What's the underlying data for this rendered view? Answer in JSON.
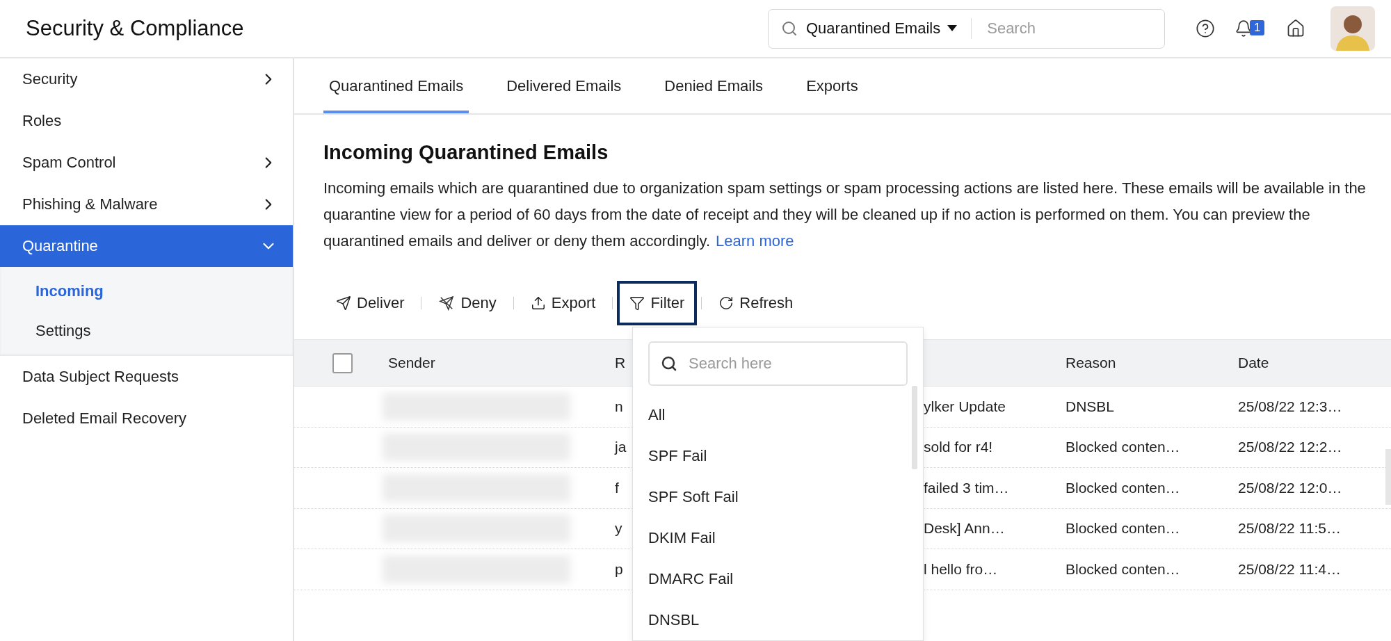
{
  "app_title": "Security & Compliance",
  "global_search": {
    "scope": "Quarantined Emails",
    "placeholder": "Search"
  },
  "notifications": {
    "count": "1"
  },
  "sidebar": {
    "items": [
      {
        "label": "Security",
        "kind": "group",
        "expanded": false,
        "selected": false
      },
      {
        "label": "Roles",
        "kind": "link",
        "selected": false
      },
      {
        "label": "Spam Control",
        "kind": "group",
        "expanded": false,
        "selected": false
      },
      {
        "label": "Phishing & Malware",
        "kind": "group",
        "expanded": false,
        "selected": false
      },
      {
        "label": "Quarantine",
        "kind": "group",
        "expanded": true,
        "selected": true,
        "children": [
          {
            "label": "Incoming",
            "selected": true
          },
          {
            "label": "Settings",
            "selected": false
          }
        ]
      },
      {
        "label": "Data Subject Requests",
        "kind": "link",
        "selected": false
      },
      {
        "label": "Deleted Email Recovery",
        "kind": "link",
        "selected": false
      }
    ]
  },
  "tabs": [
    {
      "label": "Quarantined Emails",
      "selected": true
    },
    {
      "label": "Delivered Emails",
      "selected": false
    },
    {
      "label": "Denied Emails",
      "selected": false
    },
    {
      "label": "Exports",
      "selected": false
    }
  ],
  "heading": "Incoming Quarantined Emails",
  "description": "Incoming emails which are quarantined due to organization spam settings or spam processing actions are listed here. These emails will be available in the quarantine view for a period of 60 days from the date of receipt and they will be cleaned up if no action is performed on them. You can preview the quarantined emails and deliver or deny them accordingly.",
  "learn_more": "Learn more",
  "toolbar": [
    {
      "label": "Deliver",
      "kind": "deliver",
      "selected": false
    },
    {
      "label": "Deny",
      "kind": "deny",
      "selected": false
    },
    {
      "label": "Export",
      "kind": "export",
      "selected": false
    },
    {
      "label": "Filter",
      "kind": "filter",
      "selected": true
    },
    {
      "label": "Refresh",
      "kind": "refresh",
      "selected": false
    }
  ],
  "table": {
    "select_all_checked": false,
    "columns": {
      "sender": "Sender",
      "column_3": "R",
      "reason": "Reason",
      "date": "Date"
    },
    "rows": [
      {
        "sender_redacted": true,
        "column_3": "n",
        "column_4": "ylker Update",
        "reason": "DNSBL",
        "date": "25/08/22 12:3…"
      },
      {
        "sender_redacted": true,
        "column_3": "ja",
        "column_4": "sold for r4!",
        "reason": "Blocked conten…",
        "date": "25/08/22 12:2…"
      },
      {
        "sender_redacted": true,
        "column_3": "f",
        "column_4": "failed 3 tim…",
        "reason": "Blocked conten…",
        "date": "25/08/22 12:0…"
      },
      {
        "sender_redacted": true,
        "column_3": "y",
        "column_4": "Desk] Ann…",
        "reason": "Blocked conten…",
        "date": "25/08/22 11:5…"
      },
      {
        "sender_redacted": true,
        "column_3": "p",
        "column_4": "l hello fro…",
        "reason": "Blocked conten…",
        "date": "25/08/22 11:4…"
      }
    ]
  },
  "filter_menu": {
    "search_placeholder": "Search here",
    "options": [
      {
        "label": "All"
      },
      {
        "label": "SPF Fail"
      },
      {
        "label": "SPF Soft Fail"
      },
      {
        "label": "DKIM Fail"
      },
      {
        "label": "DMARC Fail"
      },
      {
        "label": "DNSBL"
      }
    ]
  }
}
